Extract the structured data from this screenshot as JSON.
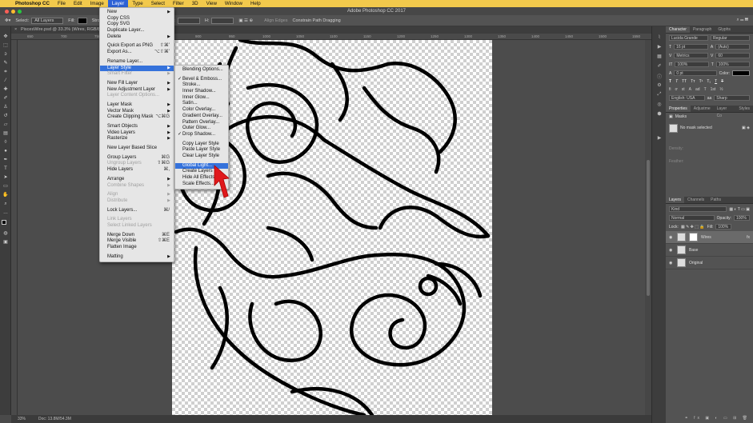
{
  "menubar": {
    "app": "Photoshop CC",
    "items": [
      "File",
      "Edit",
      "Image",
      "Layer",
      "Type",
      "Select",
      "Filter",
      "3D",
      "View",
      "Window",
      "Help"
    ],
    "active": "Layer"
  },
  "window": {
    "title": "Adobe Photoshop CC 2017",
    "doc_tab": "PiscesWire.psd @ 33.3% (Wires, RGB/8)"
  },
  "options": {
    "select_label": "Select:",
    "select_value": "All Layers",
    "fill_label": "Fill:",
    "stroke_label": "Stroke:",
    "w_label": "W:",
    "h_label": "H:",
    "align_edges": "Align Edges",
    "constrain": "Constrain Path Dragging"
  },
  "ruler_ticks": [
    "650",
    "700",
    "750",
    "800",
    "850",
    "900",
    "950",
    "1000",
    "1050",
    "1100",
    "1150",
    "1200",
    "1250",
    "1300",
    "1350",
    "1400",
    "1450",
    "1500",
    "1550"
  ],
  "status": {
    "zoom": "33%",
    "doc": "Doc: 13.8M/54.3M"
  },
  "layer_menu": [
    {
      "label": "New",
      "arrow": true
    },
    {
      "label": "Copy CSS"
    },
    {
      "label": "Copy SVG"
    },
    {
      "label": "Duplicate Layer..."
    },
    {
      "label": "Delete",
      "arrow": true
    },
    {
      "sep": true
    },
    {
      "label": "Quick Export as PNG",
      "sc": "⇧⌘'"
    },
    {
      "label": "Export As...",
      "sc": "⌥⇧⌘'"
    },
    {
      "sep": true
    },
    {
      "label": "Rename Layer..."
    },
    {
      "label": "Layer Style",
      "arrow": true,
      "hl": true
    },
    {
      "label": "Smart Filter",
      "dis": true,
      "arrow": true
    },
    {
      "sep": true
    },
    {
      "label": "New Fill Layer",
      "arrow": true
    },
    {
      "label": "New Adjustment Layer",
      "arrow": true
    },
    {
      "label": "Layer Content Options...",
      "dis": true
    },
    {
      "sep": true
    },
    {
      "label": "Layer Mask",
      "arrow": true
    },
    {
      "label": "Vector Mask",
      "arrow": true
    },
    {
      "label": "Create Clipping Mask",
      "sc": "⌥⌘G"
    },
    {
      "sep": true
    },
    {
      "label": "Smart Objects",
      "arrow": true
    },
    {
      "label": "Video Layers",
      "arrow": true
    },
    {
      "label": "Rasterize",
      "arrow": true
    },
    {
      "sep": true
    },
    {
      "label": "New Layer Based Slice"
    },
    {
      "sep": true
    },
    {
      "label": "Group Layers",
      "sc": "⌘G"
    },
    {
      "label": "Ungroup Layers",
      "sc": "⇧⌘G",
      "dis": true
    },
    {
      "label": "Hide Layers",
      "sc": "⌘,"
    },
    {
      "sep": true
    },
    {
      "label": "Arrange",
      "arrow": true
    },
    {
      "label": "Combine Shapes",
      "arrow": true,
      "dis": true
    },
    {
      "sep": true
    },
    {
      "label": "Align",
      "arrow": true,
      "dis": true
    },
    {
      "label": "Distribute",
      "arrow": true,
      "dis": true
    },
    {
      "sep": true
    },
    {
      "label": "Lock Layers...",
      "sc": "⌘/"
    },
    {
      "sep": true
    },
    {
      "label": "Link Layers",
      "dis": true
    },
    {
      "label": "Select Linked Layers",
      "dis": true
    },
    {
      "sep": true
    },
    {
      "label": "Merge Down",
      "sc": "⌘E"
    },
    {
      "label": "Merge Visible",
      "sc": "⇧⌘E"
    },
    {
      "label": "Flatten Image"
    },
    {
      "sep": true
    },
    {
      "label": "Matting",
      "arrow": true
    }
  ],
  "style_menu": [
    {
      "label": "Blending Options..."
    },
    {
      "sep": true
    },
    {
      "label": "Bevel & Emboss...",
      "ck": true
    },
    {
      "label": "Stroke..."
    },
    {
      "label": "Inner Shadow..."
    },
    {
      "label": "Inner Glow..."
    },
    {
      "label": "Satin..."
    },
    {
      "label": "Color Overlay..."
    },
    {
      "label": "Gradient Overlay..."
    },
    {
      "label": "Pattern Overlay..."
    },
    {
      "label": "Outer Glow..."
    },
    {
      "label": "Drop Shadow...",
      "ck": true
    },
    {
      "sep": true
    },
    {
      "label": "Copy Layer Style"
    },
    {
      "label": "Paste Layer Style"
    },
    {
      "label": "Clear Layer Style"
    },
    {
      "sep": true
    },
    {
      "label": "Global Light...",
      "hl": true
    },
    {
      "label": "Create Layers"
    },
    {
      "label": "Hide All Effects"
    },
    {
      "label": "Scale Effects..."
    }
  ],
  "character": {
    "tabs": [
      "Character",
      "Paragraph",
      "Glyphs"
    ],
    "font": "Lucida Grande",
    "style": "Regular",
    "size": "16 pt",
    "leading": "(Auto)",
    "kerning": "Metrics",
    "tracking": "60",
    "vscale": "100%",
    "hscale": "100%",
    "baseline": "0 pt",
    "color_label": "Color:",
    "language": "English: USA",
    "aa_label": "aa",
    "aa": "Sharp"
  },
  "properties": {
    "tabs": [
      "Properties",
      "Adjustme",
      "Layer Co",
      "Styles"
    ],
    "masks": "Masks",
    "no_mask": "No mask selected",
    "density": "Density:",
    "feather": "Feather:"
  },
  "layers": {
    "tabs": [
      "Layers",
      "Channels",
      "Paths"
    ],
    "kind": "Kind",
    "blend": "Normal",
    "opacity_label": "Opacity:",
    "opacity": "100%",
    "lock_label": "Lock:",
    "fill_label": "Fill:",
    "fill": "100%",
    "items": [
      {
        "name": "Wires",
        "fx": "fx",
        "selected": true
      },
      {
        "name": "Base"
      },
      {
        "name": "Original"
      }
    ]
  },
  "colors": {
    "menubar": "#f2c94c",
    "highlight": "#3572db",
    "arrow": "#e0191c"
  }
}
